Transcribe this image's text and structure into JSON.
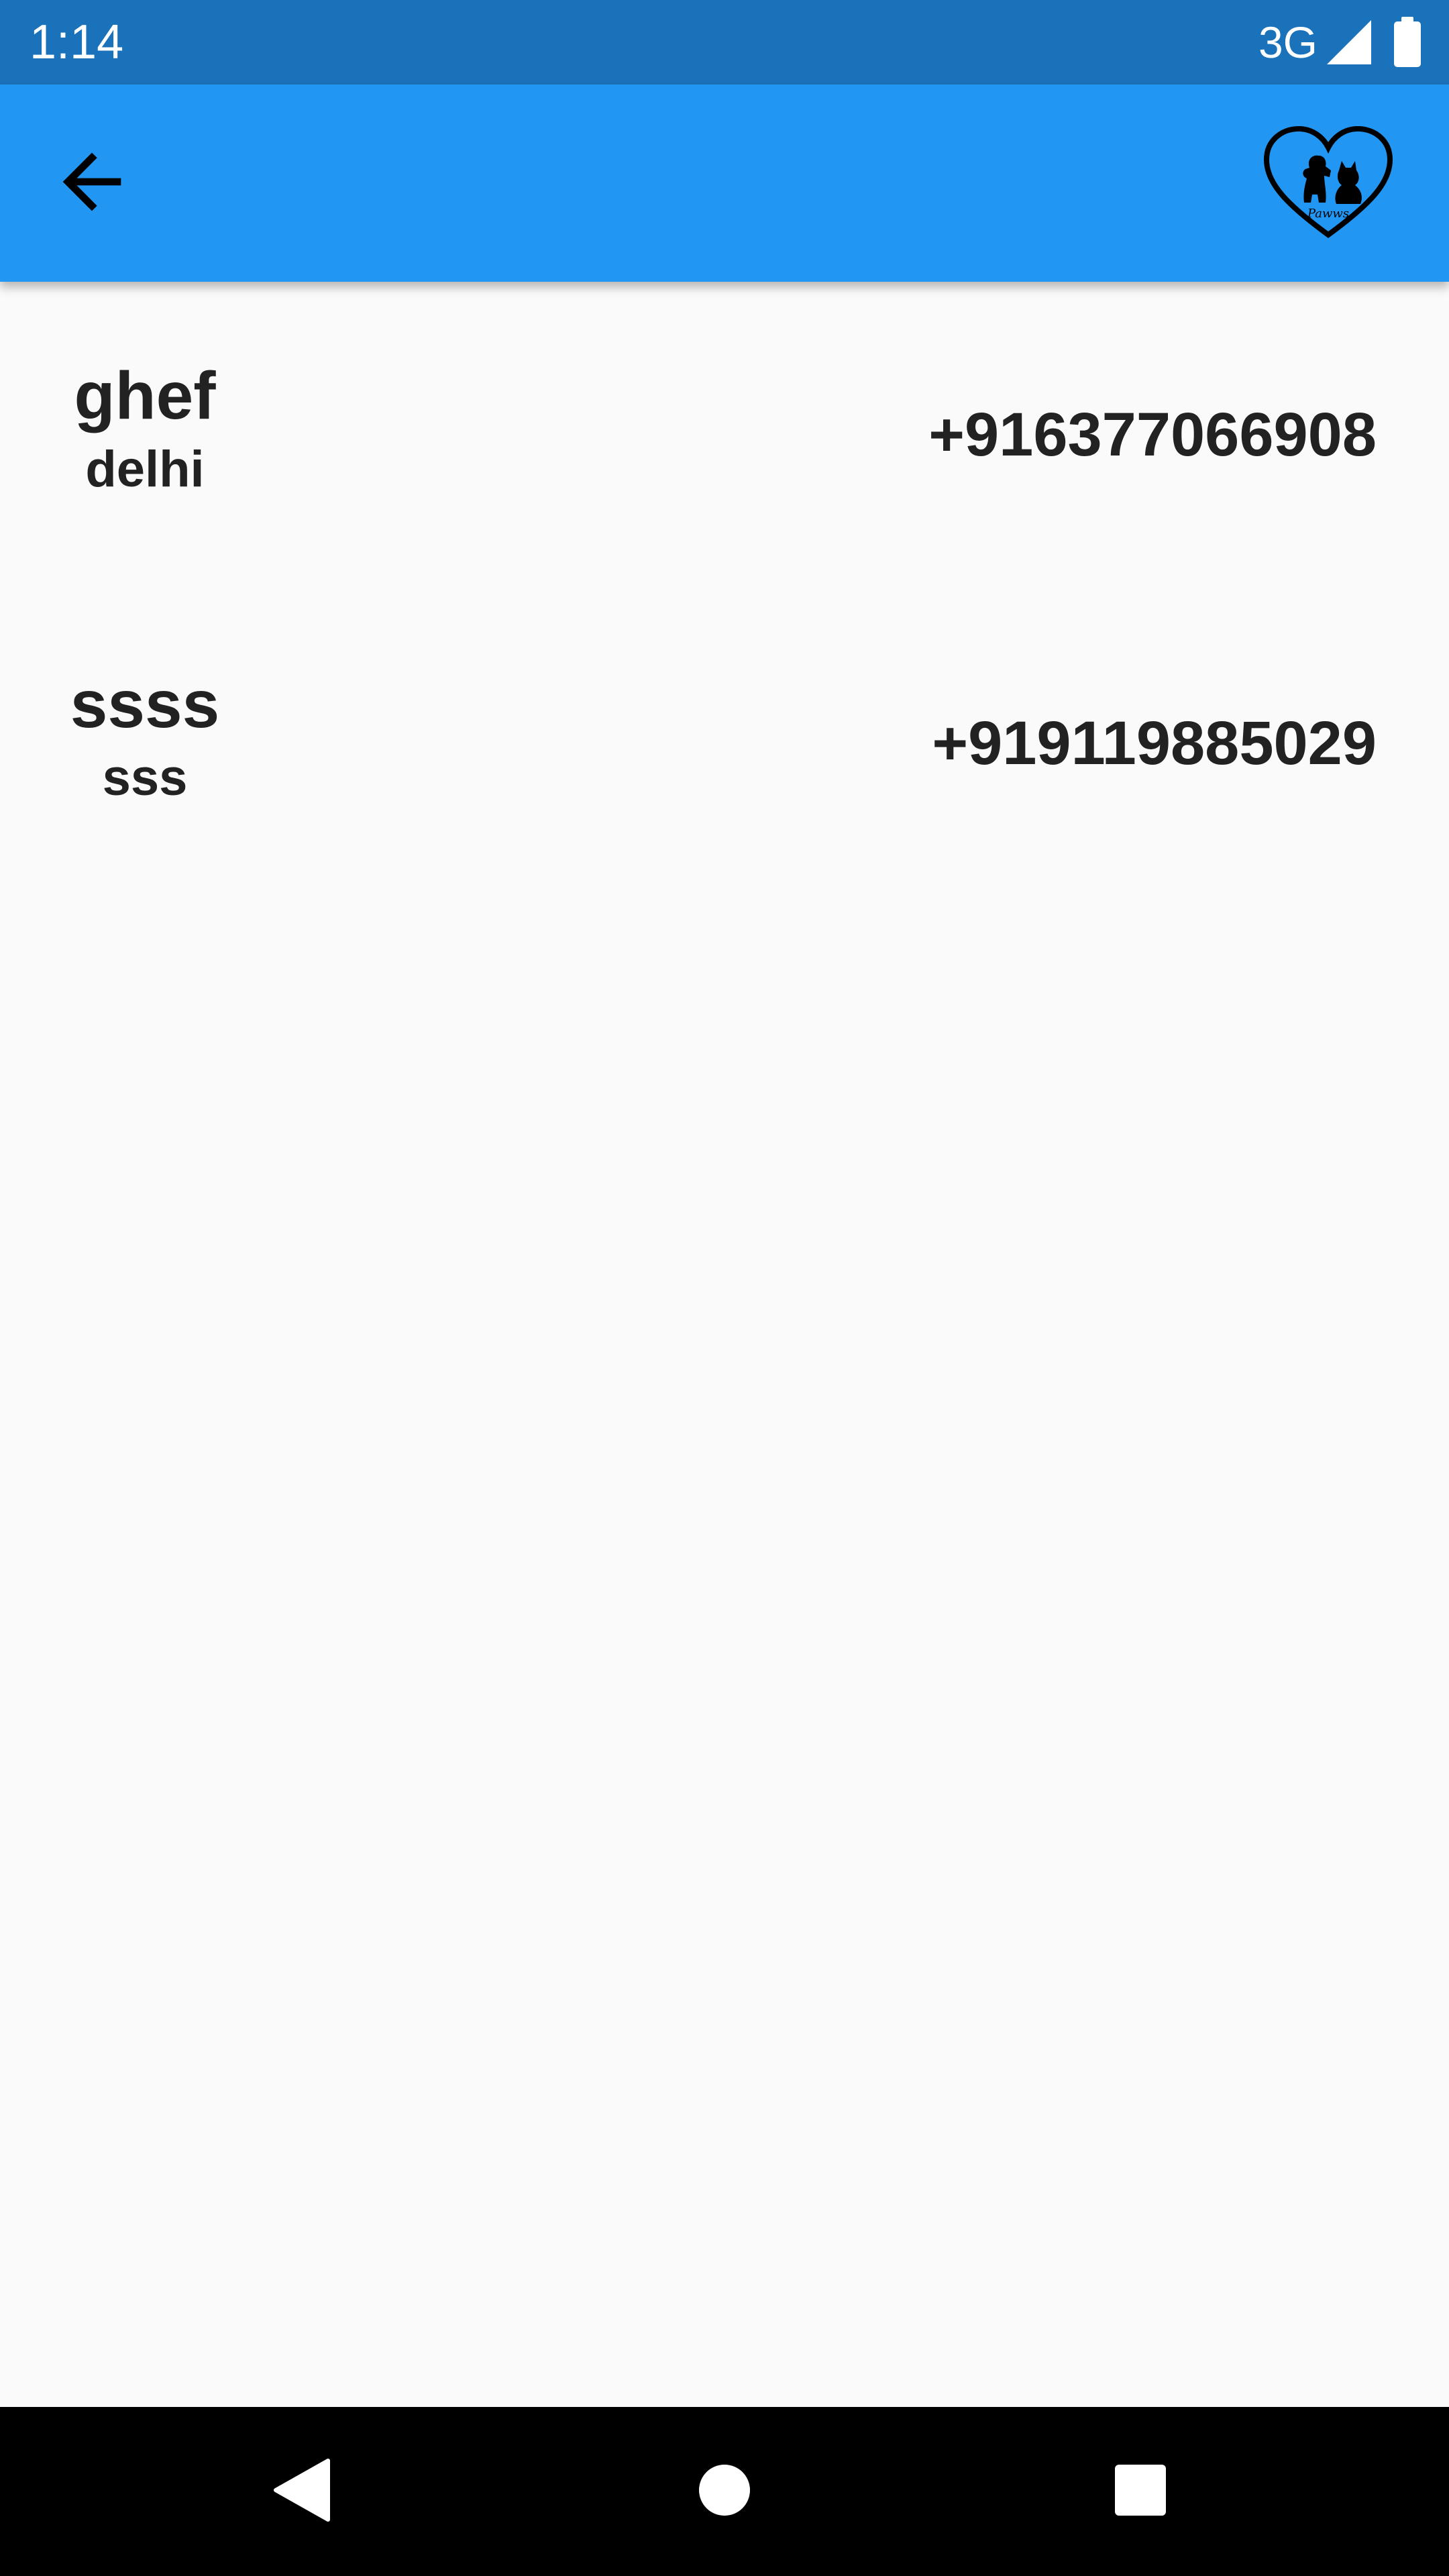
{
  "status_bar": {
    "time": "1:14",
    "network": "3G",
    "icons": [
      "signal-icon",
      "battery-icon"
    ]
  },
  "app_bar": {
    "back_icon": "arrow-left-icon",
    "logo_icon": "heart-pets-logo",
    "logo_text": "Pawws",
    "background": "#2196f3"
  },
  "contacts": [
    {
      "name": "ghef",
      "city": "delhi",
      "phone": "+916377066908"
    },
    {
      "name": "ssss",
      "city": "sss",
      "phone": "+919119885029"
    }
  ],
  "nav_bar": {
    "icons": [
      "nav-back-icon",
      "nav-home-icon",
      "nav-recents-icon"
    ]
  },
  "colors": {
    "status_bar": "#1a72bb",
    "app_bar": "#2196f3",
    "page_background": "#fafafa",
    "text": "#222222"
  }
}
